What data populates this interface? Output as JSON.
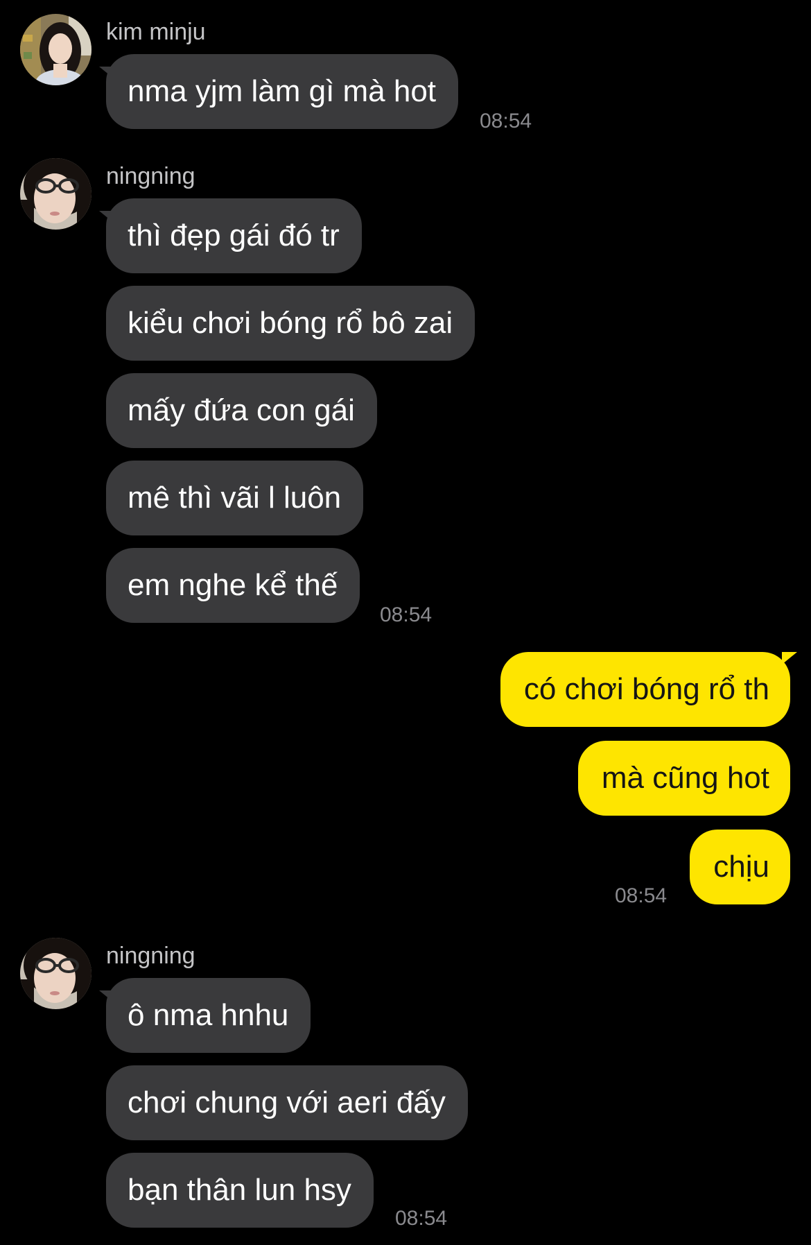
{
  "groups": [
    {
      "sender": "kim minju",
      "messages": [
        "nma yjm làm gì mà hot"
      ],
      "time": "08:54"
    },
    {
      "sender": "ningning",
      "messages": [
        "thì đẹp gái đó tr",
        "kiểu chơi bóng rổ bô zai",
        "mấy đứa con gái",
        "mê thì vãi l luôn",
        "em nghe kể thế"
      ],
      "time": "08:54"
    },
    {
      "sender": "",
      "messages": [
        "có chơi bóng rổ th",
        "mà cũng hot",
        "chịu"
      ],
      "time": "08:54"
    },
    {
      "sender": "ningning",
      "messages": [
        "ô nma hnhu",
        "chơi chung với aeri đấy",
        "bạn thân lun hsy"
      ],
      "time": "08:54"
    }
  ],
  "icons": {
    "avatar_minju": "kim-minju-avatar-photo",
    "avatar_ningning": "ningning-avatar-photo"
  },
  "colors": {
    "background": "#000000",
    "incoming_bubble": "#3a3a3c",
    "outgoing_bubble": "#fee500",
    "timestamp": "#8a8a8e"
  }
}
